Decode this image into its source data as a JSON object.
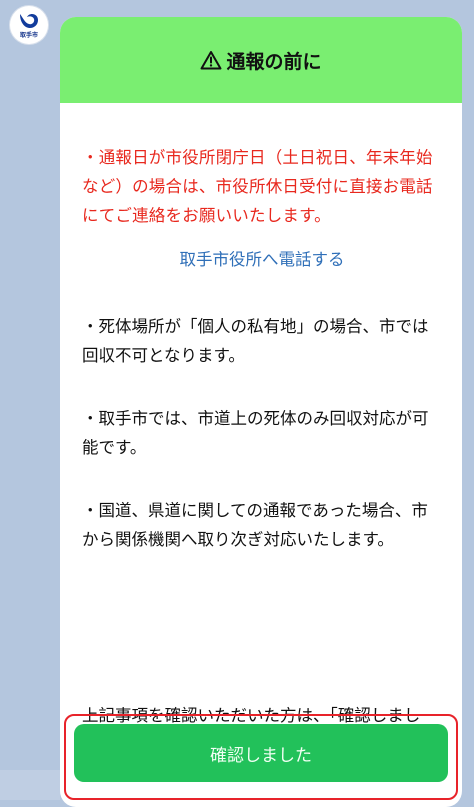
{
  "avatar": {
    "label": "取手市",
    "icon": "city-emblem-icon"
  },
  "header": {
    "icon": "warning-triangle-icon",
    "title": "通報の前に",
    "background_color": "#7aee71"
  },
  "notice": {
    "text": "・通報日が市役所閉庁日（土日祝日、年末年始など）の場合は、市役所休日受付に直接お電話にてご連絡をお願いいたします。",
    "color": "#e8281e"
  },
  "phone_link": {
    "label": "取手市役所へ電話する",
    "color": "#2f6fb8"
  },
  "info": [
    "・死体場所が「個人の私有地」の場合、市では回収不可となります。",
    "・取手市では、市道上の死体のみ回収対応が可能です。",
    "・国道、県道に関しての通報であった場合、市から関係機関へ取り次ぎ対応いたします。"
  ],
  "confirm_instruction": "上記事項を確認いただいた方は、「確認しました」ボタンを押して次へ進んでください。",
  "confirm_button": {
    "label": "確認しました",
    "color": "#22c15a",
    "highlight_color": "#e8232a"
  }
}
